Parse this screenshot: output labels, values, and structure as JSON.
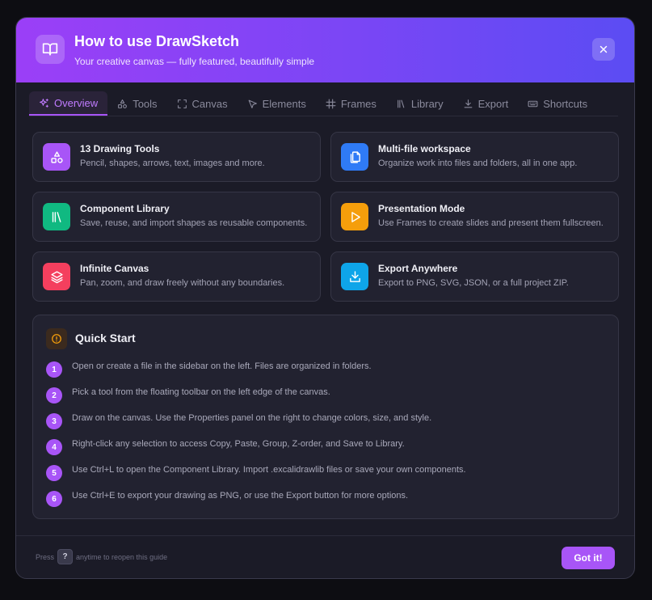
{
  "header": {
    "title": "How to use DrawSketch",
    "subtitle": "Your creative canvas — fully featured, beautifully simple",
    "icon": "book-open-icon"
  },
  "tabs": [
    {
      "label": "Overview",
      "icon": "sparkles-icon",
      "active": true
    },
    {
      "label": "Tools",
      "icon": "shapes-icon",
      "active": false
    },
    {
      "label": "Canvas",
      "icon": "expand-icon",
      "active": false
    },
    {
      "label": "Elements",
      "icon": "pointer-icon",
      "active": false
    },
    {
      "label": "Frames",
      "icon": "frame-icon",
      "active": false
    },
    {
      "label": "Library",
      "icon": "library-icon",
      "active": false
    },
    {
      "label": "Export",
      "icon": "download-icon",
      "active": false
    },
    {
      "label": "Shortcuts",
      "icon": "keyboard-icon",
      "active": false
    }
  ],
  "features": [
    {
      "title": "13 Drawing Tools",
      "desc": "Pencil, shapes, arrows, text, images and more.",
      "icon": "shapes-icon",
      "color": "#a855f7"
    },
    {
      "title": "Multi-file workspace",
      "desc": "Organize work into files and folders, all in one app.",
      "icon": "files-icon",
      "color": "#2f7bf6"
    },
    {
      "title": "Component Library",
      "desc": "Save, reuse, and import shapes as reusable components.",
      "icon": "library-icon",
      "color": "#10b981"
    },
    {
      "title": "Presentation Mode",
      "desc": "Use Frames to create slides and present them fullscreen.",
      "icon": "play-icon",
      "color": "#f59e0b"
    },
    {
      "title": "Infinite Canvas",
      "desc": "Pan, zoom, and draw freely without any boundaries.",
      "icon": "layers-icon",
      "color": "#f43f5e"
    },
    {
      "title": "Export Anywhere",
      "desc": "Export to PNG, SVG, JSON, or a full project ZIP.",
      "icon": "download-icon",
      "color": "#0ea5e9"
    }
  ],
  "quick_start": {
    "title": "Quick Start",
    "icon": "alert-circle-icon",
    "steps": [
      {
        "num": "1",
        "text": "Open or create a file in the sidebar on the left. Files are organized in folders."
      },
      {
        "num": "2",
        "text": "Pick a tool from the floating toolbar on the left edge of the canvas."
      },
      {
        "num": "3",
        "text": "Draw on the canvas. Use the Properties panel on the right to change colors, size, and style."
      },
      {
        "num": "4",
        "text": "Right-click any selection to access Copy, Paste, Group, Z-order, and Save to Library."
      },
      {
        "num": "5",
        "text": "Use Ctrl+L to open the Component Library. Import .excalidrawlib files or save your own components."
      },
      {
        "num": "6",
        "text": "Use Ctrl+E to export your drawing as PNG, or use the Export button for more options."
      }
    ]
  },
  "footer": {
    "press_label": "Press",
    "key": "?",
    "hint": "anytime to reopen this guide",
    "button_label": "Got it!"
  },
  "colors": {
    "accent": "#a855f7",
    "header_gradient_start": "#9b3ff7",
    "header_gradient_end": "#5b4cf3"
  }
}
